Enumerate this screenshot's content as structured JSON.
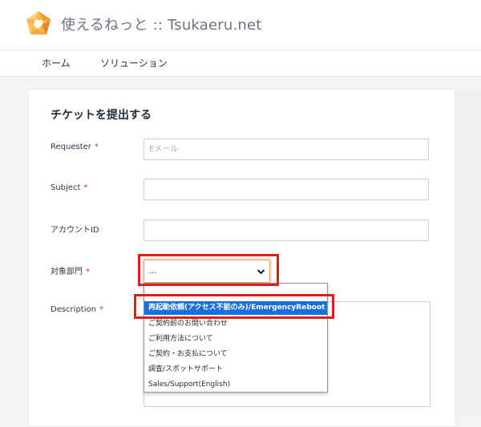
{
  "header": {
    "site_title": "使えるねっと :: Tsukaeru.net",
    "brand_color": "#f2a33a"
  },
  "nav": {
    "items": [
      {
        "label": "ホーム"
      },
      {
        "label": "ソリューション"
      }
    ]
  },
  "form": {
    "title": "チケットを提出する",
    "required_mark": "*",
    "required_color": "#d32f2f",
    "fields": {
      "requester": {
        "label": "Requester",
        "value": "",
        "placeholder": "Eメール"
      },
      "subject": {
        "label": "Subject",
        "value": ""
      },
      "account_id": {
        "label": "アカウントID",
        "value": ""
      },
      "department": {
        "label": "対象部門",
        "selected": "..."
      },
      "description": {
        "label": "Description"
      }
    }
  },
  "dropdown": {
    "options": [
      {
        "label": "...",
        "visible": false
      },
      {
        "label": "再起動依頼(アクセス不能のみ)/EmergencyReboot Request",
        "selected": true
      },
      {
        "label": "ご契約前のお問い合わせ"
      },
      {
        "label": "ご利用方法について"
      },
      {
        "label": "ご契約・お支払について"
      },
      {
        "label": "調査/スポットサポート"
      },
      {
        "label": "Sales/Support(English)"
      }
    ],
    "highlight_color": "#1a6fe0"
  },
  "annotation": {
    "box_color": "#e21b1b"
  }
}
